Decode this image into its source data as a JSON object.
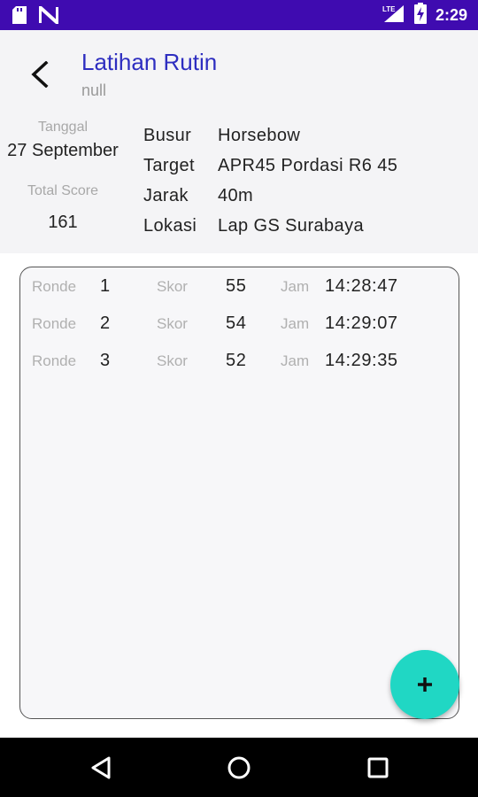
{
  "status_bar": {
    "time": "2:29",
    "network": "LTE",
    "icons": [
      "sd-card-icon",
      "notification-n-icon",
      "lte-signal-icon",
      "battery-charging-icon"
    ]
  },
  "header": {
    "title": "Latihan Rutin",
    "subtitle": "null",
    "date_label": "Tanggal",
    "date_value": "27 September",
    "score_label": "Total Score",
    "score_value": "161",
    "info": [
      {
        "key": "Busur",
        "value": "Horsebow"
      },
      {
        "key": "Target",
        "value": "APR45 Pordasi R6 45"
      },
      {
        "key": "Jarak",
        "value": "40m"
      },
      {
        "key": "Lokasi",
        "value": "Lap GS Surabaya"
      }
    ]
  },
  "rounds": {
    "round_label": "Ronde",
    "score_label": "Skor",
    "time_label": "Jam",
    "items": [
      {
        "round": "1",
        "score": "55",
        "time": "14:28:47"
      },
      {
        "round": "2",
        "score": "54",
        "time": "14:29:07"
      },
      {
        "round": "3",
        "score": "52",
        "time": "14:29:35"
      }
    ]
  },
  "fab": {
    "icon": "plus-icon",
    "color": "#20d7c4"
  },
  "colors": {
    "status_bar": "#3f0bb0",
    "title": "#2e2ec0",
    "header_bg": "#f4f4f6"
  }
}
